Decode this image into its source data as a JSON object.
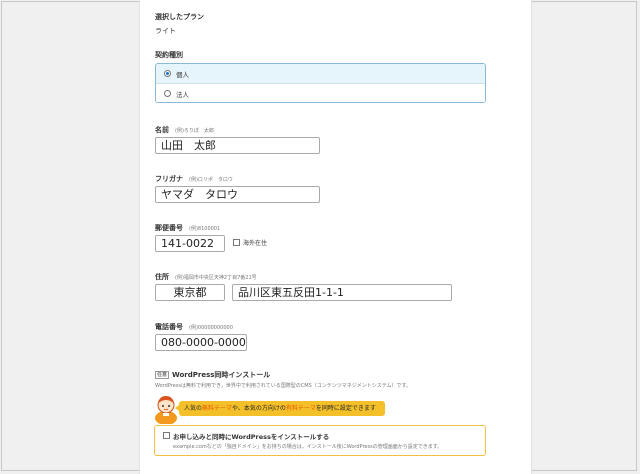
{
  "plan": {
    "label": "選択したプラン",
    "value": "ライト"
  },
  "contract": {
    "label": "契約種別",
    "options": [
      {
        "label": "個人",
        "selected": true
      },
      {
        "label": "法人",
        "selected": false
      }
    ]
  },
  "name": {
    "label": "名前",
    "example": "(例)ろりぽ　太郎",
    "value": "山田　太郎"
  },
  "furigana": {
    "label": "フリガナ",
    "example": "(例)ロリポ　タロウ",
    "value": "ヤマダ　タロウ"
  },
  "postal": {
    "label": "郵便番号",
    "example": "(例)8100001",
    "value": "141-0022",
    "overseas_label": "海外在住"
  },
  "address": {
    "label": "住所",
    "example": "(例)福岡市中央区天神2丁目7番21号",
    "prefecture": "東京都",
    "street": "品川区東五反田1-1-1"
  },
  "phone": {
    "label": "電話番号",
    "example": "(例)00000000000",
    "value": "080-0000-0000"
  },
  "wordpress": {
    "badge": "任意",
    "title": "WordPress同時インストール",
    "desc": "WordPressは無料で利用でき，世界中で利用されている国際型のCMS（コンテンツマネジメントシステム）です。",
    "banner_pre": "人気の",
    "banner_hl1": "無料テーマ",
    "banner_mid": "や、本気の方向けの",
    "banner_hl2": "有料テーマ",
    "banner_post": "を同時に設定できます",
    "checkbox_label": "お申し込みと同時にWordPressをインストールする",
    "note": "example.comなどの「独自ドメイン」をお持ちの場合は，インストール後にWordPressの管理画面から設定できます。"
  },
  "colors": {
    "accent": "#1a73c9",
    "banner": "#f4c02a",
    "highlight": "#e65a00"
  }
}
